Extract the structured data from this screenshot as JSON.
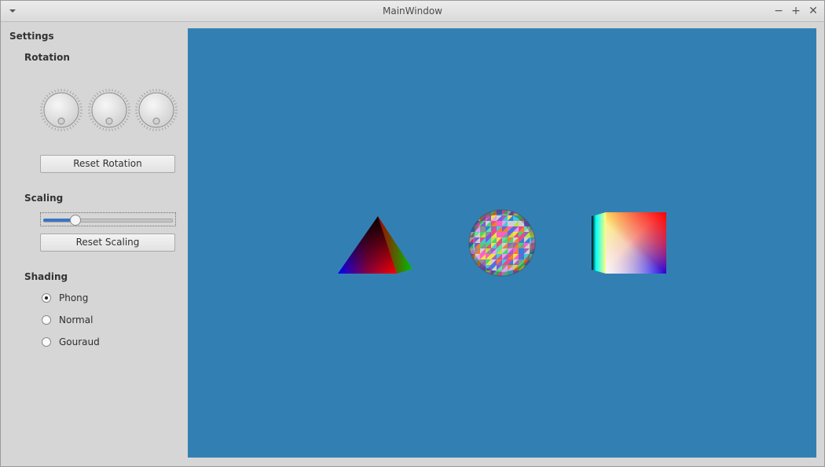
{
  "window": {
    "title": "MainWindow"
  },
  "titlebar_buttons": {
    "minimize": "−",
    "maximize": "+",
    "close": "✕"
  },
  "sidebar": {
    "settings_title": "Settings",
    "rotation": {
      "title": "Rotation",
      "reset_label": "Reset Rotation",
      "dial_icon": "dial-knob"
    },
    "scaling": {
      "title": "Scaling",
      "reset_label": "Reset Scaling",
      "value_fraction": 0.22
    },
    "shading": {
      "title": "Shading",
      "options": [
        {
          "label": "Phong",
          "selected": true
        },
        {
          "label": "Normal",
          "selected": false
        },
        {
          "label": "Gouraud",
          "selected": false
        }
      ]
    }
  },
  "viewport": {
    "background": "#3280b3",
    "objects": [
      "pyramid",
      "sphere",
      "cube"
    ]
  }
}
